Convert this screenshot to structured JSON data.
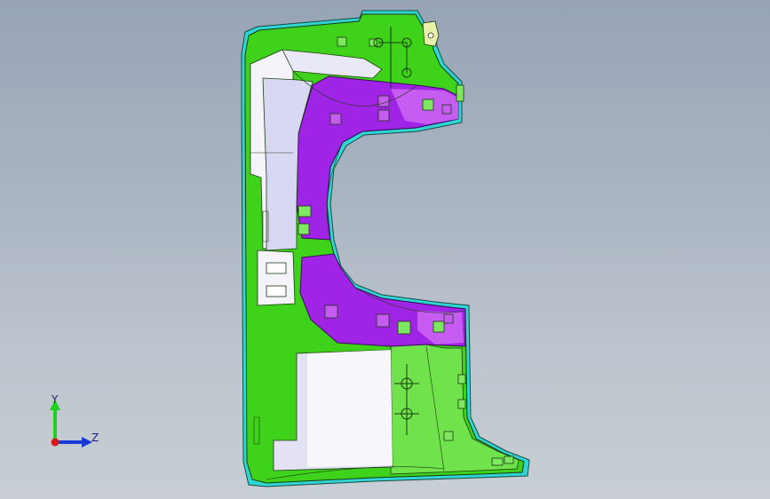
{
  "viewport": {
    "background_top": "#97a4b6",
    "background_bottom": "#c8ced4"
  },
  "model": {
    "colors": {
      "primary_green": "#3fd21a",
      "dark_green": "#2a9b12",
      "light_green": "#7ee860",
      "magenta": "#a024e6",
      "magenta_light": "#c65cf2",
      "panel_white": "#f4f4fa",
      "panel_lavender": "#d9d8f2",
      "edge_cyan": "#2fd6d6",
      "outline": "#1a3a10"
    }
  },
  "triad": {
    "y_label": "Y",
    "z_label": "Z",
    "y_color": "#1fd11f",
    "z_color": "#1a3ad6",
    "x_color": "#d61a1a"
  }
}
